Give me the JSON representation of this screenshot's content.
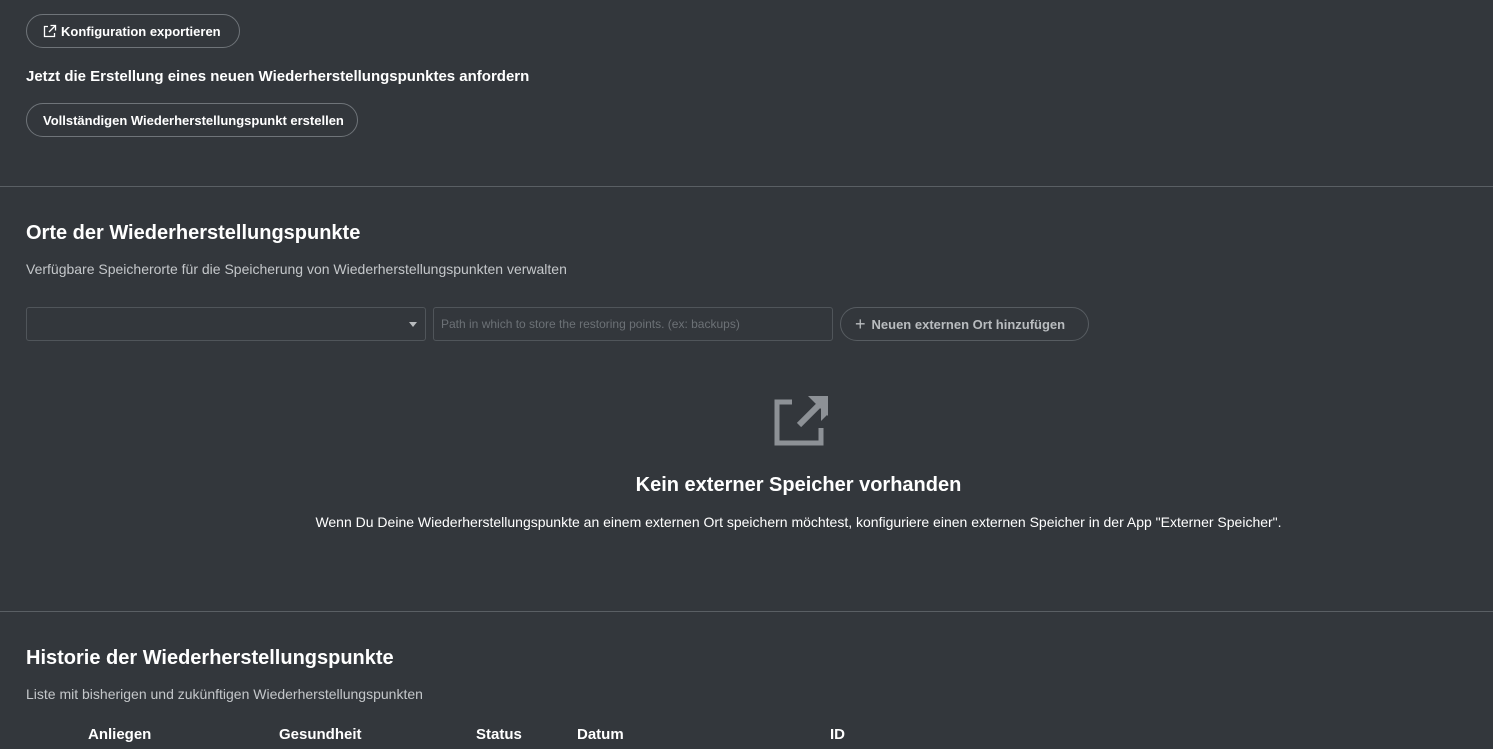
{
  "top": {
    "export_button_label": "Konfiguration exportieren",
    "request_heading": "Jetzt die Erstellung eines neuen Wiederherstellungspunktes anfordern",
    "create_button_label": "Vollständigen Wiederherstellungspunkt erstellen"
  },
  "locations": {
    "title": "Orte der Wiederherstellungspunkte",
    "description": "Verfügbare Speicherorte für die Speicherung von Wiederherstellungspunkten verwalten",
    "select_value": "",
    "path_placeholder": "Path in which to store the restoring points. (ex: backups)",
    "path_value": "",
    "add_button_label": "Neuen externen Ort hinzufügen",
    "empty_state": {
      "icon": "external-link-icon",
      "title": "Kein externer Speicher vorhanden",
      "description": "Wenn Du Deine Wiederherstellungspunkte an einem externen Ort speichern möchtest, konfiguriere einen externen Speicher in der App \"Externer Speicher\"."
    }
  },
  "history": {
    "title": "Historie der Wiederherstellungspunkte",
    "description": "Liste mit bisherigen und zukünftigen Wiederherstellungspunkten",
    "columns": [
      "Anliegen",
      "Gesundheit",
      "Status",
      "Datum",
      "ID"
    ]
  },
  "colors": {
    "background": "#33373c",
    "text": "#ffffff",
    "muted_text": "#c4c7ca",
    "border": "#6f7479",
    "divider": "#5a5f64"
  }
}
